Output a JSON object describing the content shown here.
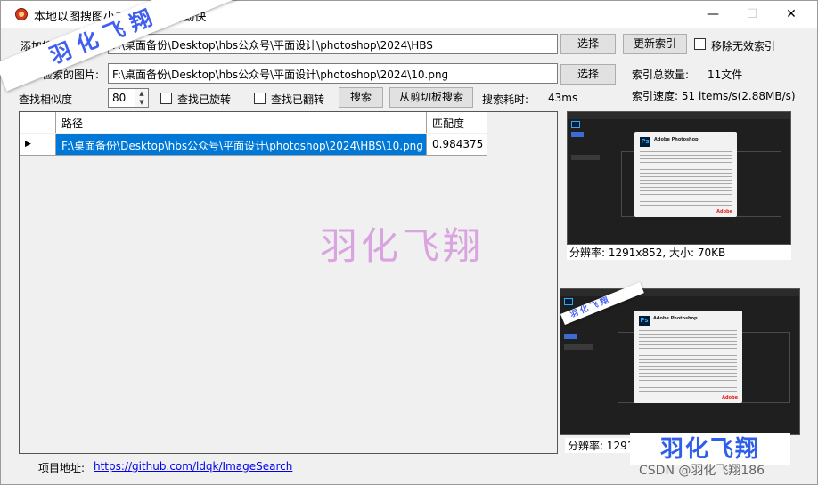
{
  "window": {
    "title": "本地以图搜图小工具 by 懒得勤快",
    "minimize_glyph": "—",
    "maximize_glyph": "☐",
    "close_glyph": "✕"
  },
  "form": {
    "folder_label": "添加搜索文件夹:",
    "folder_value": "F:\\桌面备份\\Desktop\\hbs公众号\\平面设计\\photoshop\\2024\\HBS",
    "folder_button": "选择",
    "reindex_button": "更新索引",
    "remove_invalid_label": "移除无效索引",
    "image_label": "用于检索的图片:",
    "image_value": "F:\\桌面备份\\Desktop\\hbs公众号\\平面设计\\photoshop\\2024\\10.png",
    "image_button": "选择",
    "index_total_label": "索引总数量:",
    "index_total_value": "11文件",
    "similarity_label": "查找相似度",
    "similarity_value": "80",
    "find_rotated_label": "查找已旋转",
    "find_flipped_label": "查找已翻转",
    "search_button": "搜索",
    "clipboard_search_button": "从剪切板搜索",
    "search_time_label": "搜索耗时:",
    "search_time_value": "43ms",
    "index_speed_text": "索引速度: 51 items/s(2.88MB/s)"
  },
  "results": {
    "columns": [
      "路径",
      "匹配度"
    ],
    "rows": [
      {
        "indicator": "▶",
        "path": "F:\\桌面备份\\Desktop\\hbs公众号\\平面设计\\photoshop\\2024\\HBS\\10.png",
        "score": "0.984375"
      }
    ]
  },
  "previews": [
    {
      "caption": "分辨率: 1291x852, 大小: 70KB",
      "dialog_logo": "Ps",
      "dialog_title": "Adobe Photoshop",
      "dialog_brand": "Adobe"
    },
    {
      "caption": "分辨率: 1291x85",
      "dialog_logo": "Ps",
      "dialog_title": "Adobe Photoshop",
      "dialog_brand": "Adobe"
    }
  ],
  "footer": {
    "project_label": "项目地址:",
    "project_url": "https://github.com/ldqk/ImageSearch"
  },
  "watermarks": {
    "center": "羽化飞翔",
    "ribbon_top_left": "羽 化 飞 翔",
    "ribbon_small": "羽 化 飞 翔",
    "corner": "羽化飞翔",
    "csdn": "CSDN @羽化飞翔186"
  }
}
